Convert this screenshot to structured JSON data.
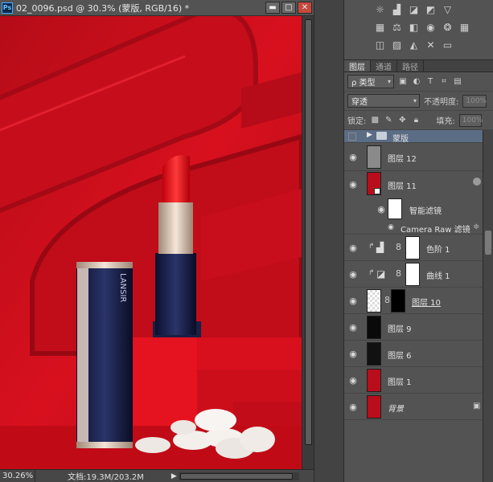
{
  "document": {
    "title": "02_0096.psd @ 30.3% (蒙版, RGB/16) *",
    "ps_logo": "Ps",
    "window_buttons": [
      "▬",
      "□",
      "✕"
    ],
    "status_zoom": "30.26%",
    "status_doc": "文档:19.3M/203.2M",
    "status_arrow": "▶",
    "product_brand": "LANSIR"
  },
  "panel_tabs": [
    "图层",
    "通道",
    "路径"
  ],
  "layers_controls": {
    "filter_kind": "ρ 类型",
    "blend_mode": "穿透",
    "opacity_label": "不透明度:",
    "opacity_value": "100%",
    "lock_label": "锁定:",
    "fill_label": "填充:",
    "fill_value": "100%"
  },
  "layers": [
    {
      "name": "蒙版",
      "type": "group",
      "visible": false
    },
    {
      "name": "图层 12",
      "type": "layer",
      "visible": true
    },
    {
      "name": "图层 11",
      "type": "smart",
      "visible": true
    },
    {
      "name": "智能滤镜",
      "type": "filter-mask",
      "visible": true
    },
    {
      "name": "Camera Raw 滤镜",
      "type": "filter",
      "visible": true
    },
    {
      "name": "色阶 1",
      "type": "adjustment",
      "visible": true
    },
    {
      "name": "曲线 1",
      "type": "adjustment",
      "visible": true
    },
    {
      "name": "图层 10",
      "type": "layer",
      "visible": true
    },
    {
      "name": "图层 9",
      "type": "layer",
      "visible": true
    },
    {
      "name": "图层 6",
      "type": "layer",
      "visible": true
    },
    {
      "name": "图层 1",
      "type": "layer",
      "visible": true
    },
    {
      "name": "背景",
      "type": "background",
      "visible": true
    }
  ],
  "colors": {
    "accent_selection": "#5b6d84",
    "canvas_red": "#d0101e",
    "panel_bg": "#535353"
  }
}
